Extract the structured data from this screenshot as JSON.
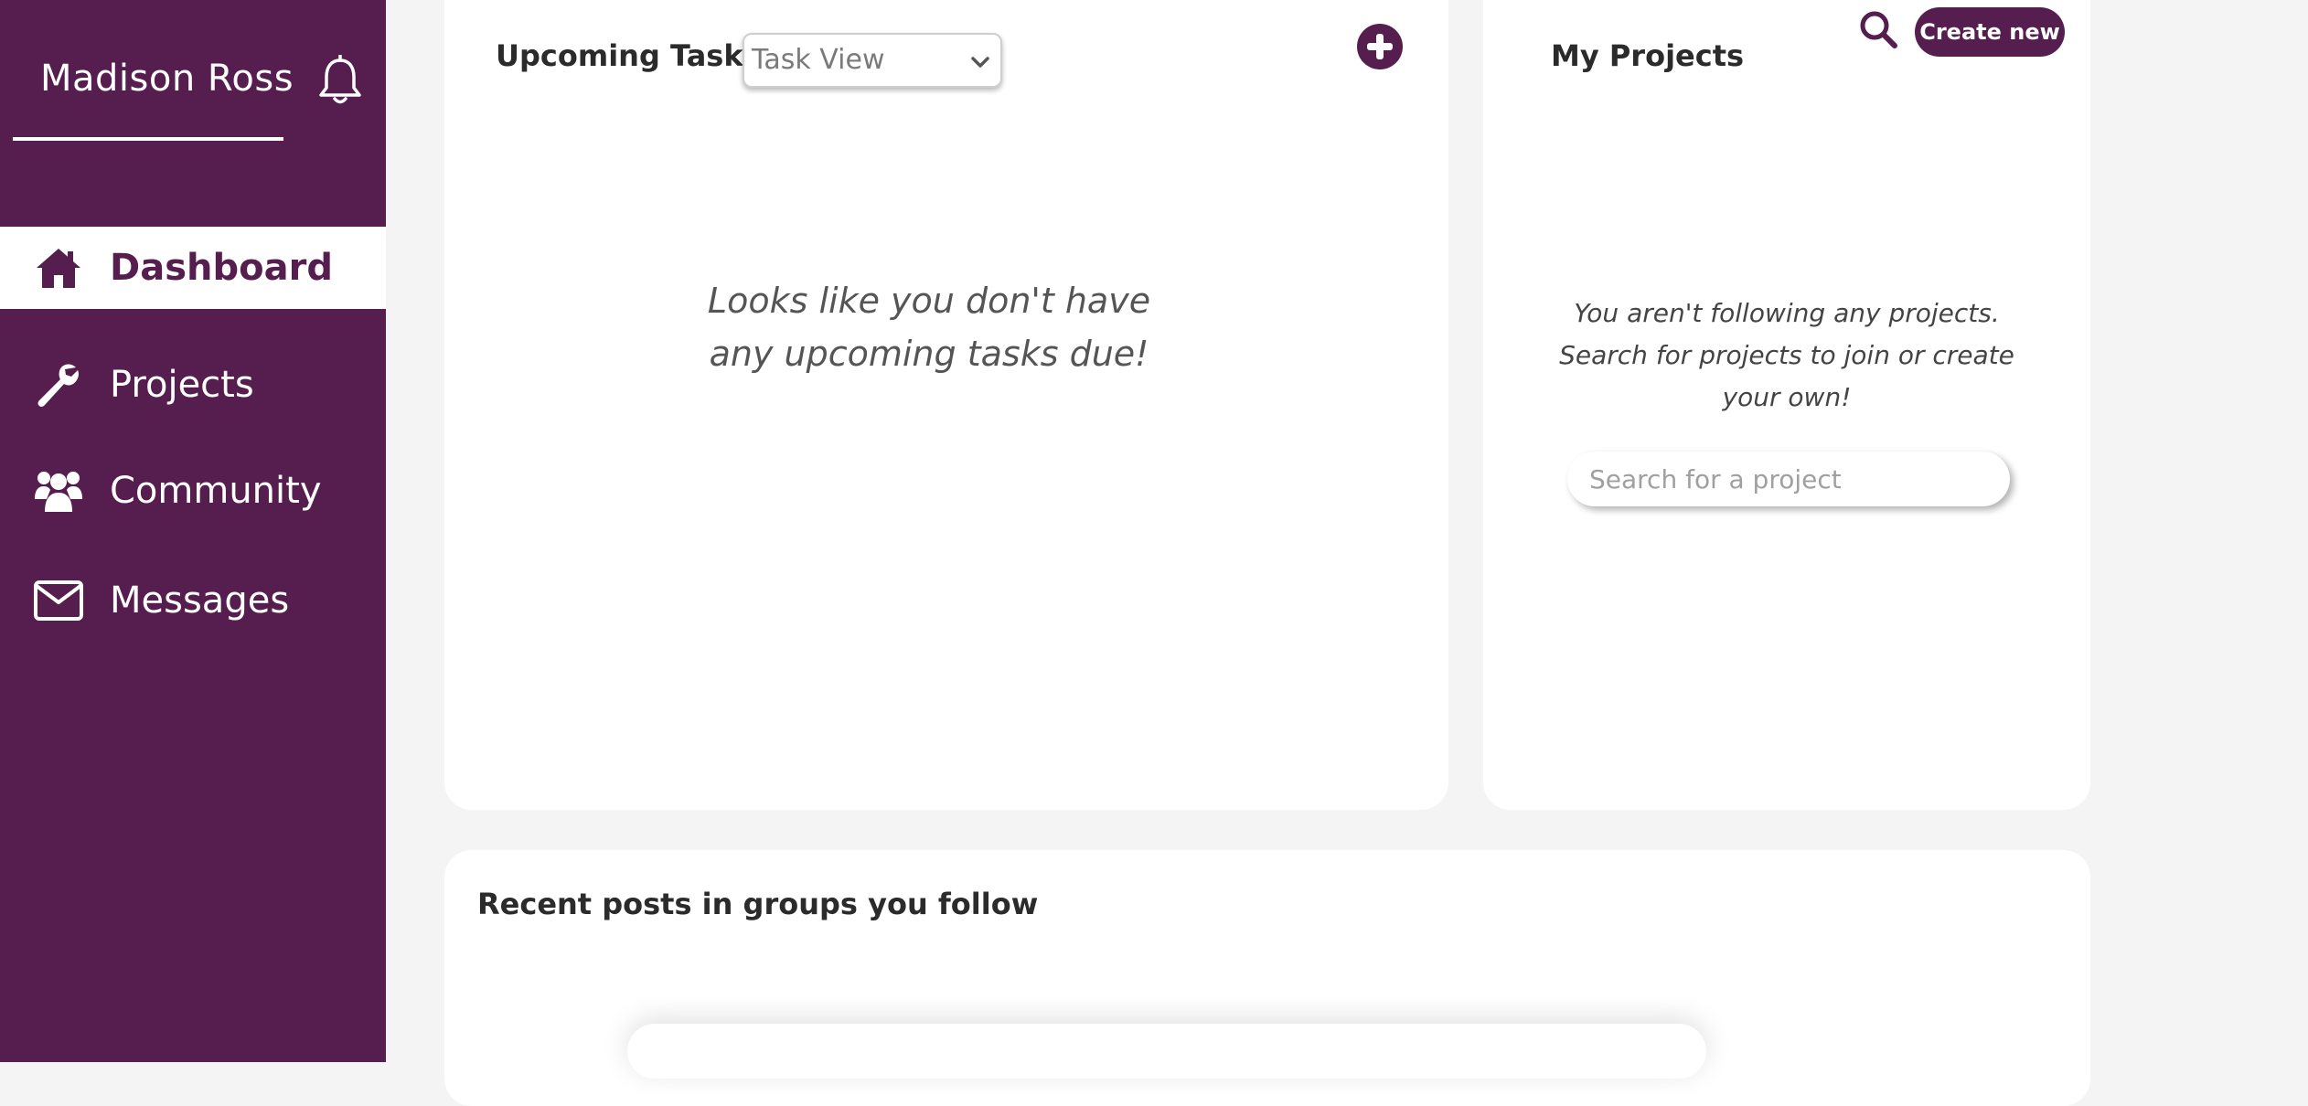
{
  "sidebar": {
    "user_name": "Madison Ross",
    "bell_icon": "bell-icon",
    "items": [
      {
        "label": "Dashboard",
        "icon": "home-icon",
        "active": true
      },
      {
        "label": "Projects",
        "icon": "wrench-icon",
        "active": false
      },
      {
        "label": "Community",
        "icon": "users-icon",
        "active": false
      },
      {
        "label": "Messages",
        "icon": "envelope-icon",
        "active": false
      }
    ]
  },
  "tasks": {
    "title": "Upcoming Tasks",
    "select_value": "Task View",
    "add_icon": "plus-circle-icon",
    "empty_message": "Looks like you don't have any upcoming tasks due!"
  },
  "projects": {
    "title": "My Projects",
    "search_icon": "search-icon",
    "create_label": "Create new",
    "empty_message": "You aren't following any projects. Search for projects to join or create your own!",
    "search_placeholder": "Search for a project"
  },
  "posts": {
    "title": "Recent posts in groups you follow"
  },
  "colors": {
    "brand": "#561d4f",
    "background": "#f4f4f4",
    "card": "#ffffff"
  }
}
